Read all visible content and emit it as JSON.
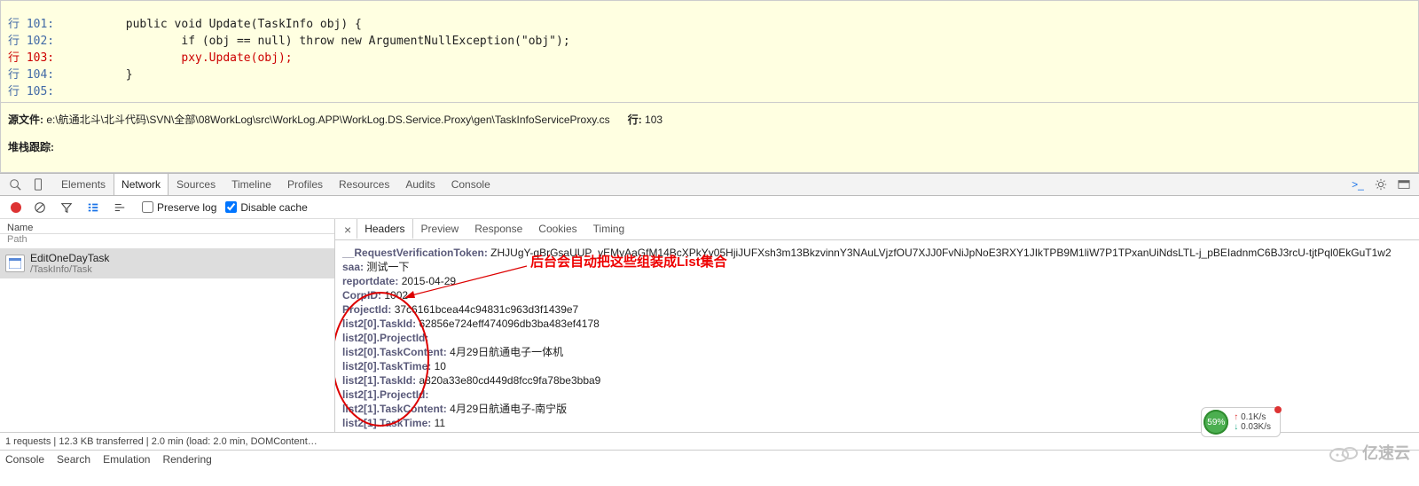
{
  "code": {
    "lines": [
      {
        "ln": "行 101:",
        "txt": "        public void Update(TaskInfo obj) {"
      },
      {
        "ln": "行 102:",
        "txt": "                if (obj == null) throw new ArgumentNullException(\"obj\");"
      },
      {
        "ln": "行 103:",
        "txt": "                pxy.Update(obj);",
        "hl": true
      },
      {
        "ln": "行 104:",
        "txt": "        }"
      },
      {
        "ln": "行 105:",
        "txt": ""
      }
    ]
  },
  "source_file_label": "源文件:",
  "source_file": "e:\\航通北斗\\北斗代码\\SVN\\全部\\08WorkLog\\src\\WorkLog.APP\\WorkLog.DS.Service.Proxy\\gen\\TaskInfoServiceProxy.cs",
  "line_label": "行:",
  "line_no": "103",
  "stack_label": "堆栈跟踪:",
  "devtools_tabs": [
    "Elements",
    "Network",
    "Sources",
    "Timeline",
    "Profiles",
    "Resources",
    "Audits",
    "Console"
  ],
  "toolbar": {
    "preserve": "Preserve log",
    "disable": "Disable cache"
  },
  "left": {
    "h1": "Name",
    "h2": "Path",
    "row": {
      "title": "EditOneDayTask",
      "sub": "/TaskInfo/Task"
    }
  },
  "right": {
    "tabs": [
      "Headers",
      "Preview",
      "Response",
      "Cookies",
      "Timing"
    ],
    "annotation": "后台会自动把这些组装成List集合",
    "items": [
      {
        "k": "__RequestVerificationToken:",
        "v": "ZHJUgY-qBrGsaUUP_yEMyAaGfM14BcXPkYy05HjiJUFXsh3m13BkzvinnY3NAuLVjzfOU7XJJ0FvNiJpNoE3RXY1JIkTPB9M1liW7P1TPxanUiNdsLTL-j_pBEIadnmC6BJ3rcU-tjtPql0EkGuT1w2"
      },
      {
        "k": "saa:",
        "v": "测试一下"
      },
      {
        "k": "reportdate:",
        "v": "2015-04-29"
      },
      {
        "k": "CorpID:",
        "v": "1002"
      },
      {
        "k": "ProjectId:",
        "v": "37c6161bcea44c94831c963d3f1439e7"
      },
      {
        "k": "list2[0].TaskId:",
        "v": "62856e724eff474096db3ba483ef4178"
      },
      {
        "k": "list2[0].ProjectId:",
        "v": ""
      },
      {
        "k": "list2[0].TaskContent:",
        "v": "4月29日航通电子一体机"
      },
      {
        "k": "list2[0].TaskTime:",
        "v": "10"
      },
      {
        "k": "list2[1].TaskId:",
        "v": "a820a33e80cd449d8fcc9fa78be3bba9"
      },
      {
        "k": "list2[1].ProjectId:",
        "v": ""
      },
      {
        "k": "list2[1].TaskContent:",
        "v": "4月29日航通电子-南宁版"
      },
      {
        "k": "list2[1].TaskTime:",
        "v": "11"
      }
    ]
  },
  "status1": "1 requests | 12.3 KB transferred | 2.0 min (load: 2.0 min, DOMContent…",
  "status2": [
    "Console",
    "Search",
    "Emulation",
    "Rendering"
  ],
  "netbadge": {
    "pct": "59%",
    "up": "0.1K/s",
    "down": "0.03K/s"
  },
  "watermark": "亿速云"
}
